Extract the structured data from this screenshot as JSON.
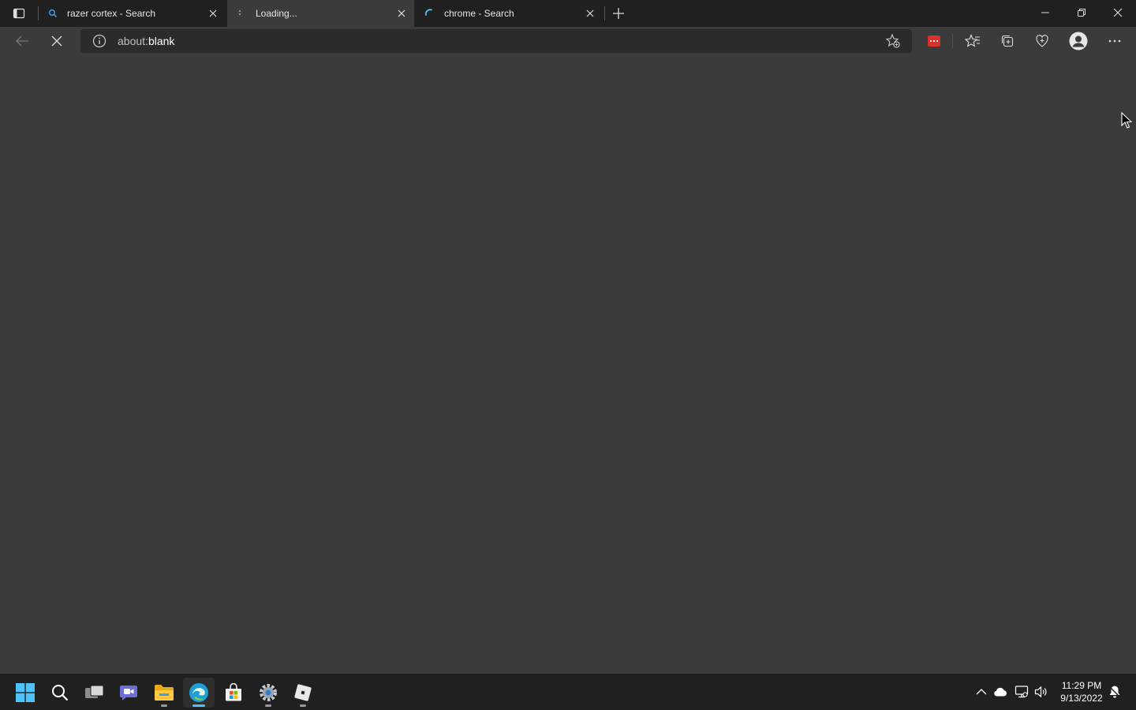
{
  "browser": {
    "tabs": [
      {
        "title": "razer cortex - Search",
        "icon": "search-favicon-icon",
        "active": false
      },
      {
        "title": "Loading...",
        "icon": "loading-spinner-icon",
        "active": true
      },
      {
        "title": "chrome - Search",
        "icon": "loading-spinner-icon",
        "active": false
      }
    ],
    "address": {
      "prefix": "about:",
      "host": "blank"
    }
  },
  "taskbar": {
    "apps": [
      "start",
      "search",
      "task-view",
      "chat",
      "file-explorer",
      "edge",
      "store",
      "settings",
      "roblox"
    ],
    "time": "11:29 PM",
    "date": "9/13/2022"
  },
  "colors": {
    "accent": "#4cc2ff",
    "titlebar": "#202020",
    "page": "#3b3b3b"
  }
}
